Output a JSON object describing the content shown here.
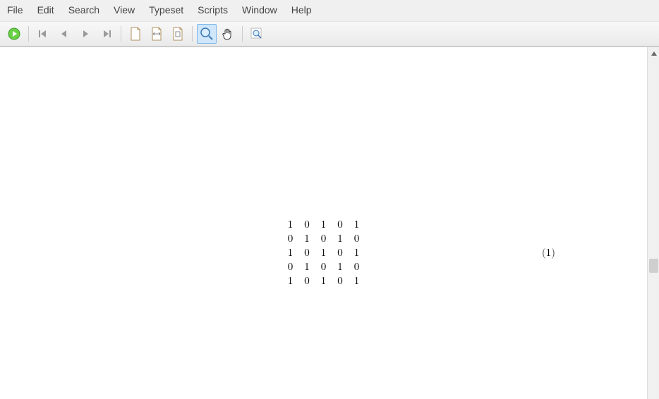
{
  "menubar": {
    "items": [
      {
        "label": "File"
      },
      {
        "label": "Edit"
      },
      {
        "label": "Search"
      },
      {
        "label": "View"
      },
      {
        "label": "Typeset"
      },
      {
        "label": "Scripts"
      },
      {
        "label": "Window"
      },
      {
        "label": "Help"
      }
    ]
  },
  "toolbar": {
    "play_icon": "play",
    "first_icon": "first",
    "prev_icon": "prev",
    "next_icon": "next",
    "last_icon": "last",
    "newdoc_icon": "new-document",
    "doc2_icon": "document-2",
    "doc3_icon": "document-3",
    "zoom_icon": "magnifier",
    "pan_icon": "hand",
    "zoom_region_icon": "zoom-region"
  },
  "equation": {
    "matrix": [
      [
        "1",
        "0",
        "1",
        "0",
        "1"
      ],
      [
        "0",
        "1",
        "0",
        "1",
        "0"
      ],
      [
        "1",
        "0",
        "1",
        "0",
        "1"
      ],
      [
        "0",
        "1",
        "0",
        "1",
        "0"
      ],
      [
        "1",
        "0",
        "1",
        "0",
        "1"
      ]
    ],
    "number": "(1)"
  }
}
